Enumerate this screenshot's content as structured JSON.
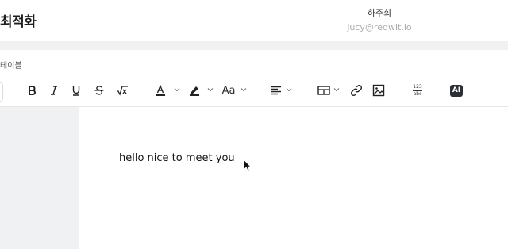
{
  "header": {
    "title": "최적화",
    "user_name": "하주희",
    "user_email": "jucy@redwit.io"
  },
  "breadcrumb": {
    "label": "테이블"
  },
  "toolbar": {
    "font_size_label": "Aa",
    "number_label_top": "123",
    "number_label_bottom": "abc",
    "ai_label": "AI",
    "colors": {
      "text_underline": "#222222",
      "highlight_underline": "#222222"
    }
  },
  "editor": {
    "content": "hello nice to meet you"
  }
}
